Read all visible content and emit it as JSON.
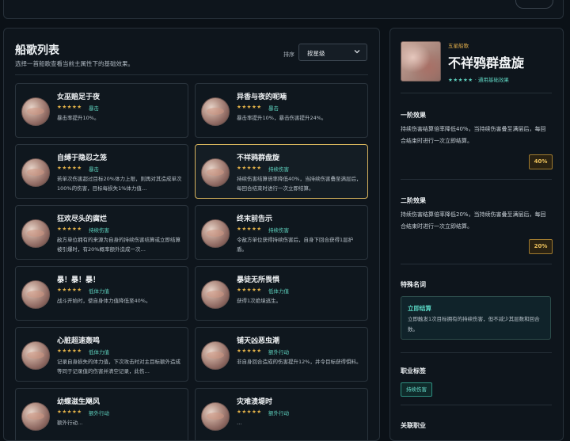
{
  "list": {
    "title": "船歌列表",
    "subtitle": "选择一首船歌查看当前主属性下的基础效果。",
    "sort_label": "排序",
    "sort_value": "按星级",
    "cards": [
      {
        "name": "女巫赔足于夜",
        "stars": "★★★★★",
        "tag": "暴击",
        "desc": "暴击率提升10%。"
      },
      {
        "name": "异香与夜的呢喃",
        "stars": "★★★★★",
        "tag": "暴击",
        "desc": "暴击率提升10%，暴击伤害提升24%。"
      },
      {
        "name": "自缚于隐忍之笼",
        "stars": "★★★★★",
        "tag": "暴击",
        "desc": "若单次伤害超过目标20%体力上限，则再对其造成单次100%的伤害，目标每损失1%体力值…"
      },
      {
        "name": "不祥鸦群盘旋",
        "stars": "★★★★★",
        "tag": "持续伤害",
        "desc": "持续伤害结算倍率降低40%，当持续伤害叠至满层后，每回合结束时进行一次立即结算。"
      },
      {
        "name": "狂欢尽头的腐烂",
        "stars": "★★★★★",
        "tag": "持续伤害",
        "desc": "敌方单位拥有的来源为自身的持续伤害结算或立即结算被引爆时，有20%概率额外造成一次…"
      },
      {
        "name": "终末前告示",
        "stars": "★★★★★",
        "tag": "持续伤害",
        "desc": "令敌方单位获得持续伤害后，自身下回合获得1层护盾。"
      },
      {
        "name": "暴！暴！暴！",
        "stars": "★★★★★",
        "tag": "低体力值",
        "desc": "战斗开始时，使自身体力值降低至40%。"
      },
      {
        "name": "暴徒无所畏惧",
        "stars": "★★★★★",
        "tag": "低体力值",
        "desc": "获得1次绝境逃生。"
      },
      {
        "name": "心脏超速轰鸣",
        "stars": "★★★★★",
        "tag": "低体力值",
        "desc": "记录自身损失的体力值，下次攻击时对主目标额外造成等同于记录值的伤害并清空记录，此伤…"
      },
      {
        "name": "铺天凶恶虫潮",
        "stars": "★★★★★",
        "tag": "额外行动",
        "desc": "非自身回合造成的伤害提升12%，并令目标获得惧料。"
      },
      {
        "name": "幼蝶滋生飓风",
        "stars": "★★★★★",
        "tag": "额外行动",
        "desc": "额外行动…"
      },
      {
        "name": "灾难溃堤时",
        "stars": "★★★★★",
        "tag": "额外行动",
        "desc": "…"
      }
    ]
  },
  "detail": {
    "rarity": "五星船歌",
    "title": "不祥鸦群盘旋",
    "stars": "★★★★★",
    "stars_note": "· 通用基础效果",
    "stage1_title": "一阶效果",
    "stage1_text": "持续伤害结算倍率降低40%，当持续伤害叠至满层后，每回合结束时进行一次立即结算。",
    "stage1_badge": "40%",
    "stage2_title": "二阶效果",
    "stage2_text": "持续伤害结算倍率降低20%，当持续伤害叠至满层后，每回合结束时进行一次立即结算。",
    "stage2_badge": "20%",
    "special_title": "特殊名词",
    "special_name": "立即结算",
    "special_desc": "立即触发1次目标拥有的持续伤害，但不减少其层数和回合数。",
    "job_title": "职业标签",
    "job_tag": "持续伤害",
    "related_title": "关联职业"
  },
  "colors": {
    "accent": "#5fd4c0",
    "gold": "#e7b54a",
    "selected_border": "#d7b45d"
  }
}
